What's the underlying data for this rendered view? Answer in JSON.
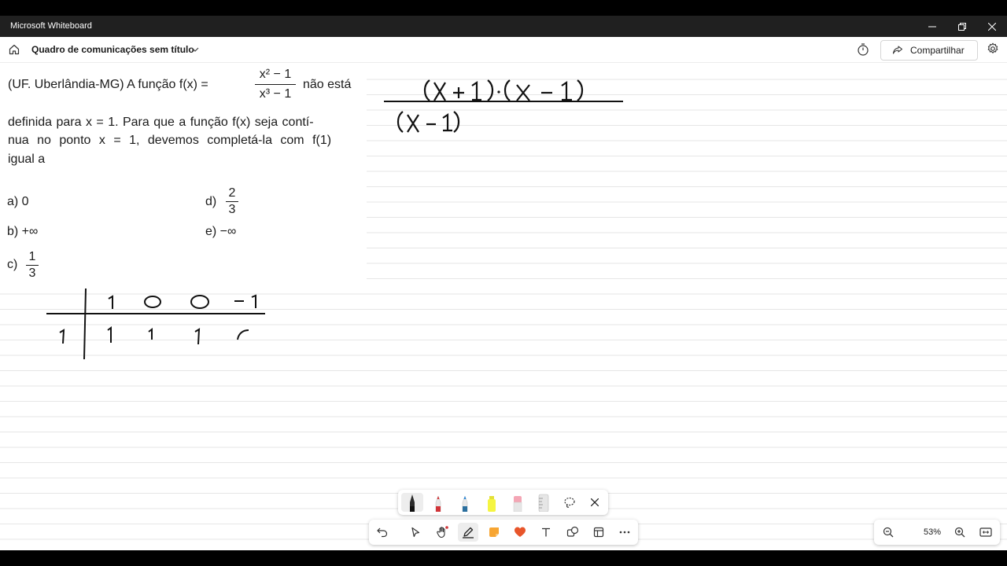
{
  "window": {
    "app_title": "Microsoft Whiteboard",
    "minimize_icon": "minimize-icon",
    "restore_icon": "restore-icon",
    "close_icon": "close-icon"
  },
  "header": {
    "board_title": "Quadro de comunicações sem título",
    "share_label": "Compartilhar"
  },
  "problem": {
    "line1_prefix": "(UF. Uberlândia-MG) A função f(x) =",
    "fraction_num": "x² − 1",
    "fraction_den": "x³ − 1",
    "line1_suffix": "não está",
    "line2": "definida para x = 1. Para que a função f(x) seja contí-",
    "line3": "nua no ponto x = 1, devemos completá-la com f(1)",
    "line4": "igual a",
    "options": {
      "a": "a) 0",
      "b": "b) +∞",
      "c_prefix": "c)",
      "c_num": "1",
      "c_den": "3",
      "d_prefix": "d)",
      "d_num": "2",
      "d_den": "3",
      "e": "e) −∞"
    }
  },
  "handwriting": {
    "numerator": "(x + 1)·(x − 1)",
    "denominator": "(x − 1)",
    "briot_top": [
      "1",
      "0",
      "0",
      "−1"
    ],
    "briot_divisor": "1",
    "briot_bottom": [
      "1",
      "1",
      "1"
    ]
  },
  "pen_colors": {
    "black": "#1a1a1a",
    "red": "#d13438",
    "blue": "#2b88d8",
    "yellow": "#f5f542",
    "pink": "#f4a6b5"
  },
  "zoom": {
    "level": "53%"
  }
}
